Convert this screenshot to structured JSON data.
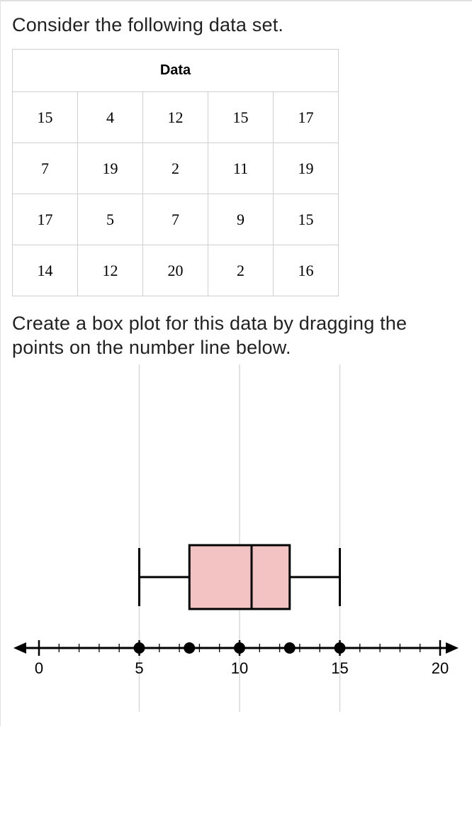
{
  "prompt_text": "Consider the following data set.",
  "table_header": "Data",
  "data_rows": [
    [
      15,
      4,
      12,
      15,
      17
    ],
    [
      7,
      19,
      2,
      11,
      19
    ],
    [
      17,
      5,
      7,
      9,
      15
    ],
    [
      14,
      12,
      20,
      2,
      16
    ]
  ],
  "instruction_text": "Create a box plot for this data by dragging the points on the number line below.",
  "chart_data": {
    "type": "boxplot",
    "title": "",
    "xlabel": "",
    "ylabel": "",
    "xlim": [
      0,
      20
    ],
    "ticks_major": [
      0,
      5,
      10,
      15,
      20
    ],
    "ticks_minor_step": 1,
    "gridlines": [
      5,
      10,
      15
    ],
    "points": [
      5,
      7.5,
      10,
      12.5,
      15
    ],
    "box": {
      "whisker_low": 5,
      "q1": 7.5,
      "median": 10.6,
      "q3": 12.5,
      "whisker_high": 15
    },
    "colors": {
      "box_fill": "#f3c3c3",
      "box_stroke": "#000000"
    }
  }
}
